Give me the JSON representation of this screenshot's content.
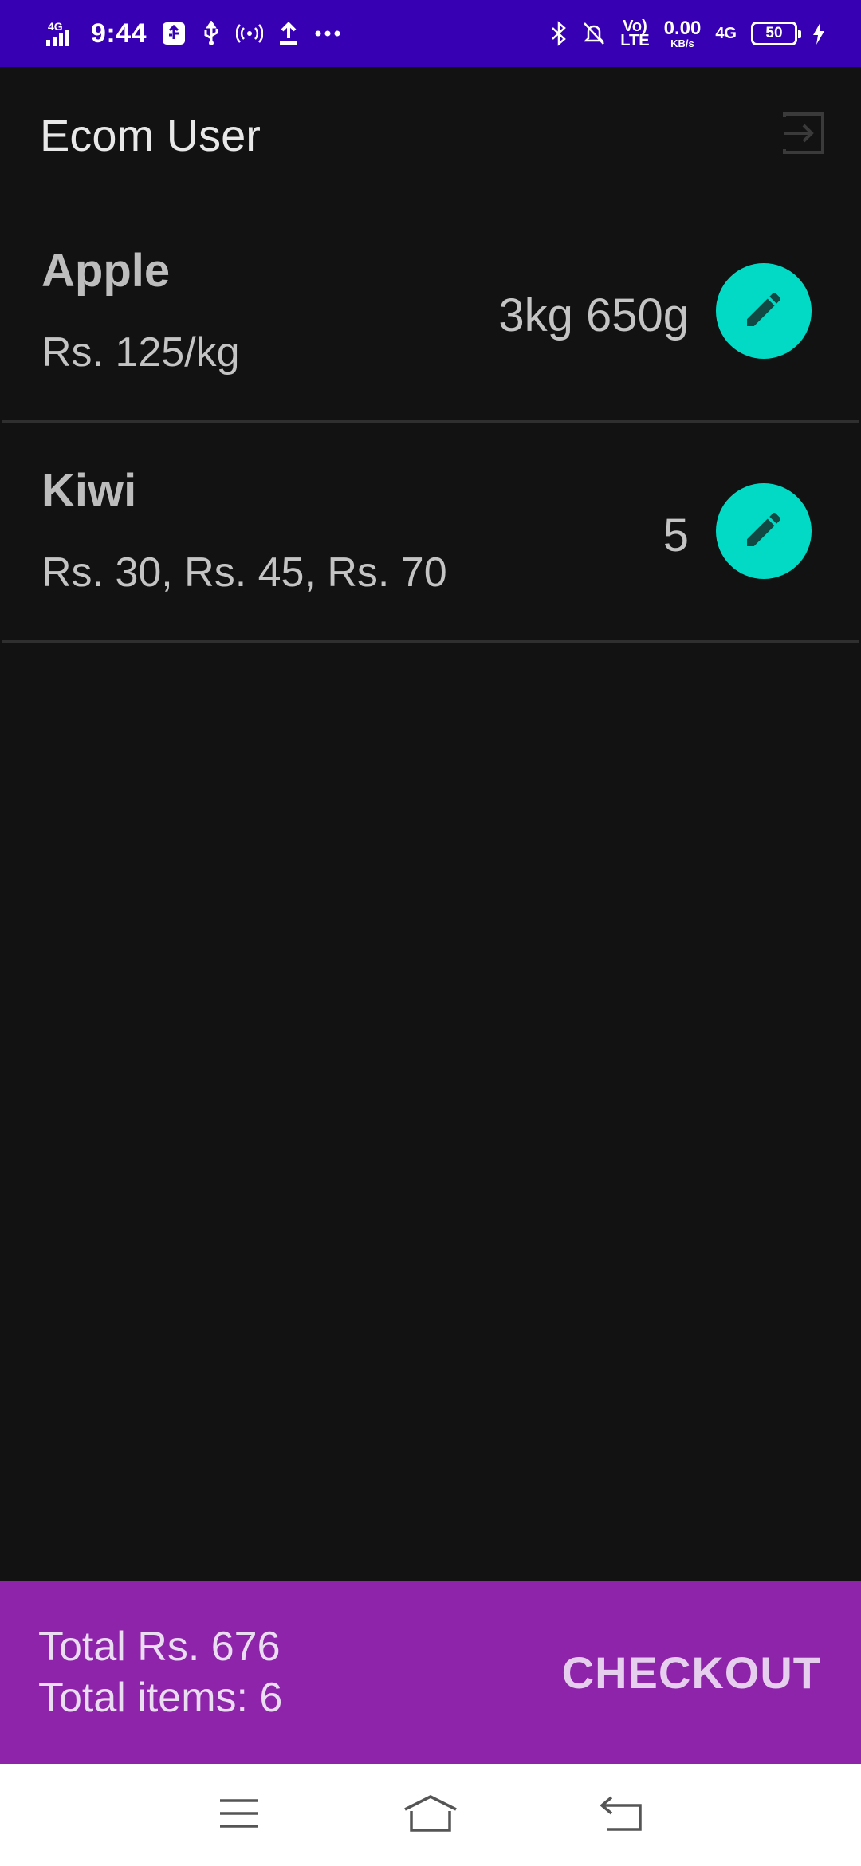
{
  "status_bar": {
    "network_left": "4G",
    "time": "9:44",
    "volte": "Vo)\nLTE",
    "speed_value": "0.00",
    "speed_unit": "KB/s",
    "network_right": "4G",
    "battery": "50"
  },
  "app_bar": {
    "title": "Ecom User",
    "logout_icon": "logout-icon"
  },
  "items": [
    {
      "name": "Apple",
      "price": "Rs. 125/kg",
      "quantity": "3kg 650g",
      "edit_icon": "pencil-icon"
    },
    {
      "name": "Kiwi",
      "price": "Rs. 30,  Rs. 45,  Rs. 70",
      "quantity": "5",
      "edit_icon": "pencil-icon"
    }
  ],
  "summary": {
    "total": "Total Rs. 676",
    "total_items": "Total items: 6",
    "checkout_label": "CHECKOUT"
  },
  "nav_bar": {
    "menu_icon": "menu-icon",
    "home_icon": "home-icon",
    "back_icon": "back-icon"
  },
  "colors": {
    "status_bar": "#3700B3",
    "background": "#121212",
    "fab": "#03DAC5",
    "summary_bar": "#8E24AA"
  }
}
